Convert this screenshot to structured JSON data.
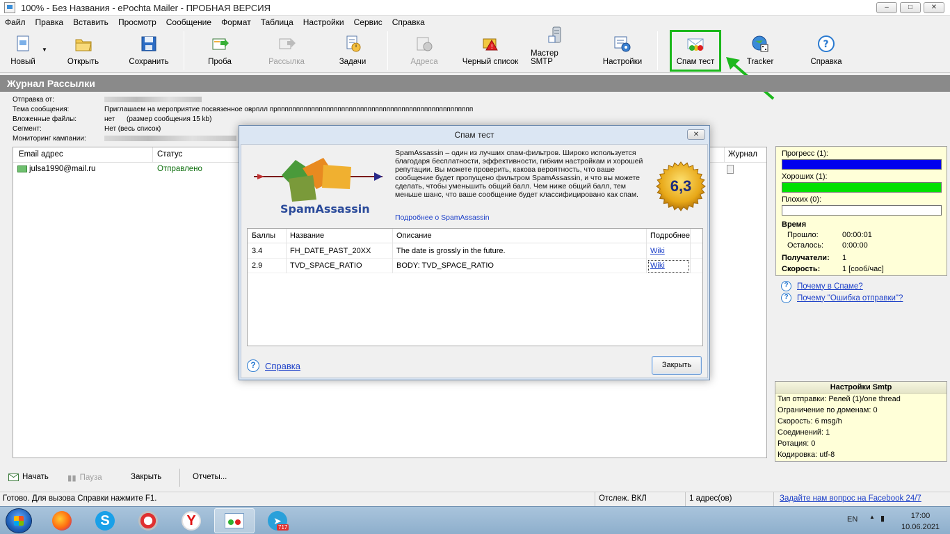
{
  "window": {
    "title": "100% - Без Названия - ePochta Mailer - ПРОБНАЯ ВЕРСИЯ",
    "controls": [
      "–",
      "□",
      "✕"
    ]
  },
  "menu": [
    "Файл",
    "Правка",
    "Вставить",
    "Просмотр",
    "Сообщение",
    "Формат",
    "Таблица",
    "Настройки",
    "Сервис",
    "Справка"
  ],
  "toolbar": {
    "new": "Новый",
    "open": "Открыть",
    "save": "Сохранить",
    "test": "Проба",
    "mailing": "Рассылка",
    "tasks": "Задачи",
    "addresses": "Адреса",
    "blacklist": "Черный список",
    "smtp_wizard": "Мастер SMTP",
    "settings": "Настройки",
    "spam_test": "Спам тест",
    "tracker": "Tracker",
    "help": "Справка"
  },
  "log": {
    "header": "Журнал Рассылки",
    "from_label": "Отправка от:",
    "subject_label": "Тема сообщения:",
    "subject_value": "Приглашаем на мероприятие посвязенное оврплл прппппппппппппппппппппппппппппппппппппппппппппппппппппппппппппппппппппппппппппппппппппппппппппппппппппппппппппппппп",
    "attachments_label": "Вложенные файлы:",
    "attachments_value": "нет      (размер сообщения 15 kb)",
    "segment_label": "Сегмент:",
    "segment_value": "Нет (весь список)",
    "monitoring_label": "Мониторинг кампании:"
  },
  "list": {
    "col_email": "Email адрес",
    "col_status": "Статус",
    "col_log": "Журнал",
    "rows": [
      {
        "email": "julsa1990@mail.ru",
        "status": "Отправлено"
      }
    ]
  },
  "stats": {
    "progress_label": "Прогресс (1):",
    "good_label": "Хороших (1):",
    "bad_label": "Плохих (0):",
    "progress_fraction": 1.0,
    "good_fraction": 1.0,
    "bad_fraction": 0.0,
    "time_label": "Время",
    "elapsed_label": "Прошло:",
    "elapsed_value": "00:00:01",
    "remaining_label": "Осталось:",
    "remaining_value": "0:00:00",
    "recipients_label": "Получатели:",
    "recipients_value": "1",
    "speed_label": "Скорость:",
    "speed_value": "1 [сооб/час]",
    "colors": {
      "progress": "#0000ee",
      "good": "#00e000",
      "bad": "#ffffff"
    }
  },
  "help_links": {
    "why_spam": "Почему в Спаме?",
    "why_error": "Почему \"Ошибка отправки\"?"
  },
  "smtp": {
    "title": "Настройки Smtp",
    "lines": [
      "Тип отправки: Релей (1)/one thread",
      "Ограничение по доменам: 0",
      "Скорость: 6 msg/h",
      "Соединений: 1",
      "Ротация: 0",
      "Кодировка: utf-8"
    ]
  },
  "bottom": {
    "start": "Начать",
    "pause": "Пауза",
    "close": "Закрыть",
    "reports": "Отчеты..."
  },
  "statusbar": {
    "ready": "Готово. Для вызова Справки нажмите F1.",
    "tracking": "Отслеж. ВКЛ",
    "addresses": "1 адрес(ов)",
    "facebook": "Задайте нам вопрос на Facebook 24/7"
  },
  "taskbar": {
    "lang": "EN",
    "time": "17:00",
    "date": "10.06.2021",
    "telegram_badge": "717"
  },
  "dialog": {
    "title": "Спам тест",
    "close_x": "✕",
    "logo_text": "SpamAssassin",
    "description": "SpamAssassin – один из лучших спам-фильтров.  Широко используется благодаря бесплатности,  эффективности, гибким настройкам и хорошей репутации. Вы можете проверить, какова вероятность, что ваше сообщение будет пропущено фильтром SpamAssassin, и что вы можете сделать, чтобы уменьшить общий балл. Чем ниже общий балл, тем меньше шанс, что ваше сообщение будет классифицировано как спам.",
    "more_link": "Подробнее о SpamAssassin",
    "score": "6,3",
    "table": {
      "headers": {
        "points": "Баллы",
        "name": "Название",
        "description": "Описание",
        "details": "Подробнее"
      },
      "rows": [
        {
          "points": "3.4",
          "name": "FH_DATE_PAST_20XX",
          "description": "The date is grossly in the future.",
          "details": "Wiki"
        },
        {
          "points": "2.9",
          "name": "TVD_SPACE_RATIO",
          "description": "BODY: TVD_SPACE_RATIO",
          "details": "Wiki"
        }
      ]
    },
    "help": "Справка",
    "close_button": "Закрыть"
  }
}
